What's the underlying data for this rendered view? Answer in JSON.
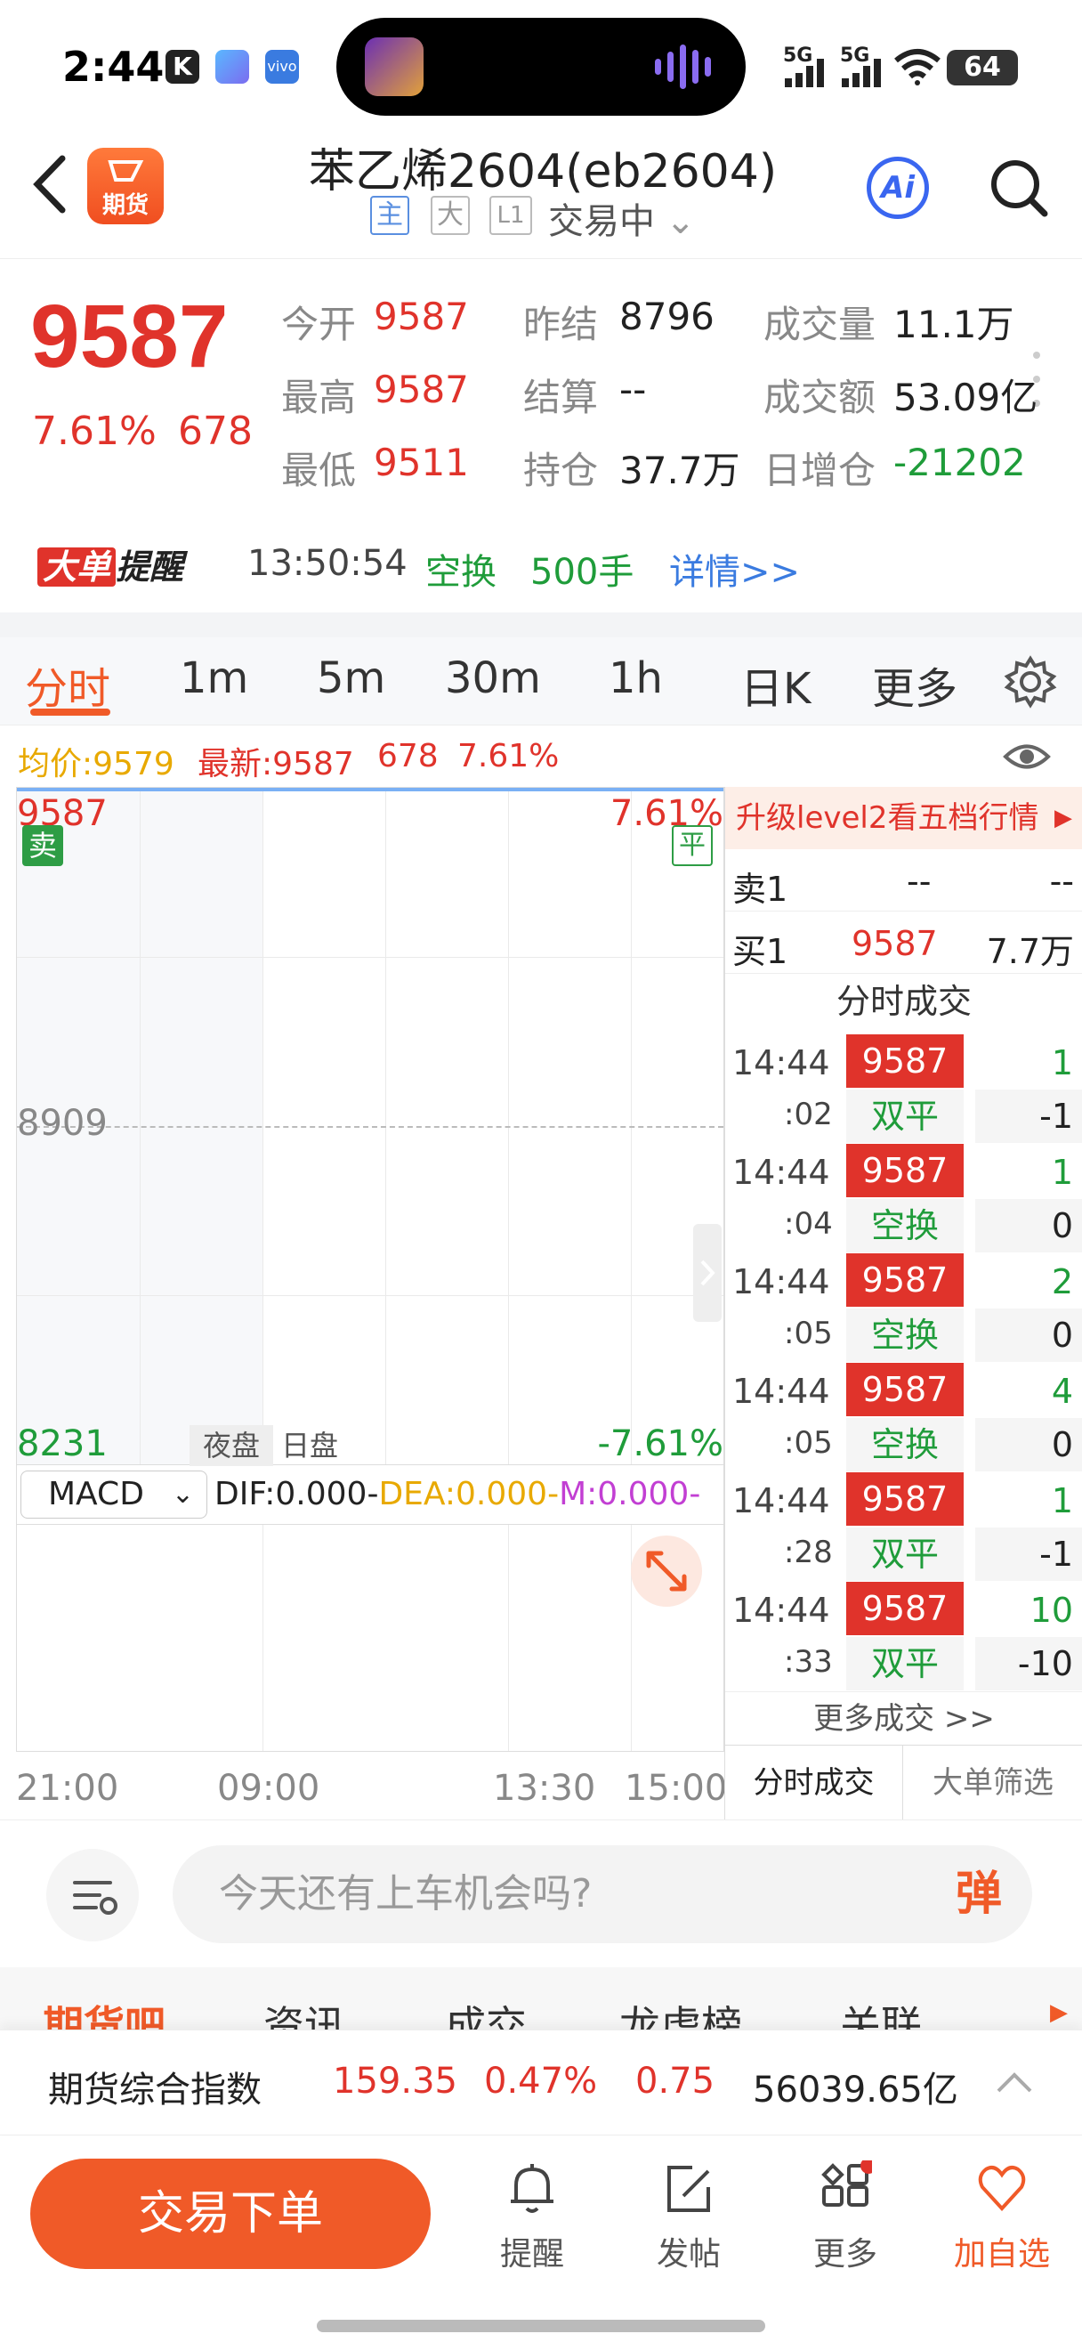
{
  "status": {
    "time": "2:44",
    "signal1": "5G",
    "signal2": "5G",
    "battery": "64"
  },
  "header": {
    "logo_text": "期货",
    "title": "苯乙烯2604(eb2604)",
    "tags": [
      "主",
      "大",
      "L1"
    ],
    "trading_status": "交易中",
    "ai_label": "Ai"
  },
  "quote": {
    "price": "9587",
    "pct": "7.61%",
    "change": "678",
    "fields": [
      {
        "k": "今开",
        "v": "9587",
        "c": "red"
      },
      {
        "k": "昨结",
        "v": "8796",
        "c": "black"
      },
      {
        "k": "成交量",
        "v": "11.1万",
        "c": "black"
      },
      {
        "k": "最高",
        "v": "9587",
        "c": "red"
      },
      {
        "k": "结算",
        "v": "--",
        "c": "black"
      },
      {
        "k": "成交额",
        "v": "53.09亿",
        "c": "black"
      },
      {
        "k": "最低",
        "v": "9511",
        "c": "red"
      },
      {
        "k": "持仓",
        "v": "37.7万",
        "c": "black"
      },
      {
        "k": "日增仓",
        "v": "-21202",
        "c": "green"
      }
    ]
  },
  "big_order": {
    "logo_a": "大单",
    "logo_b": "提醒",
    "time": "13:50:54",
    "type": "空换",
    "size": "500手",
    "link": "详情>>"
  },
  "tabs": {
    "items": [
      "分时",
      "1m",
      "5m",
      "30m",
      "1h",
      "日K",
      "更多"
    ]
  },
  "avg_line": {
    "avg": "均价:9579",
    "latest": "最新:9587",
    "chg": "678",
    "pct": "7.61%"
  },
  "chart": {
    "top_price": "9587",
    "top_pct": "7.61%",
    "mid_price": "8909",
    "bottom_price": "8231",
    "bottom_pct": "-7.61%",
    "sell_tag": "卖",
    "flat_tag": "平",
    "night_label": "夜盘",
    "day_label": "日盘",
    "x_labels": [
      "21:00",
      "09:00",
      "13:30",
      "15:00"
    ]
  },
  "macd": {
    "selector": "MACD",
    "dif": "DIF:0.000-",
    "dea": "DEA:0.000-",
    "m": "M:0.000-"
  },
  "panel": {
    "level2": "升级level2看五档行情",
    "sell1": {
      "label": "卖1",
      "price": "--",
      "vol": "--"
    },
    "buy1": {
      "label": "买1",
      "price": "9587",
      "vol": "7.7万"
    },
    "trades_title": "分时成交",
    "trades": [
      {
        "time": "14:44",
        "sec": ":02",
        "price": "9587",
        "vol": "1",
        "type": "双平",
        "oi": "-1"
      },
      {
        "time": "14:44",
        "sec": ":04",
        "price": "9587",
        "vol": "1",
        "type": "空换",
        "oi": "0"
      },
      {
        "time": "14:44",
        "sec": ":05",
        "price": "9587",
        "vol": "2",
        "type": "空换",
        "oi": "0"
      },
      {
        "time": "14:44",
        "sec": ":05",
        "price": "9587",
        "vol": "4",
        "type": "空换",
        "oi": "0"
      },
      {
        "time": "14:44",
        "sec": ":28",
        "price": "9587",
        "vol": "1",
        "type": "双平",
        "oi": "-1"
      },
      {
        "time": "14:44",
        "sec": ":33",
        "price": "9587",
        "vol": "10",
        "type": "双平",
        "oi": "-10"
      }
    ],
    "more": "更多成交 >>",
    "tab1": "分时成交",
    "tab2": "大单筛选"
  },
  "comment": {
    "placeholder": "今天还有上车机会吗?",
    "danmu": "弹"
  },
  "sections": [
    "期货吧",
    "资讯",
    "成交",
    "龙虎榜",
    "关联"
  ],
  "index_bar": {
    "name": "期货综合指数",
    "value": "159.35",
    "pct": "0.47%",
    "chg": "0.75",
    "amount": "56039.65亿"
  },
  "nav": {
    "order_btn": "交易下单",
    "items": [
      "提醒",
      "发帖",
      "更多",
      "加自选"
    ]
  },
  "colors": {
    "accent": "#f05a28",
    "up": "#e0332b",
    "down": "#1f9c3a"
  }
}
